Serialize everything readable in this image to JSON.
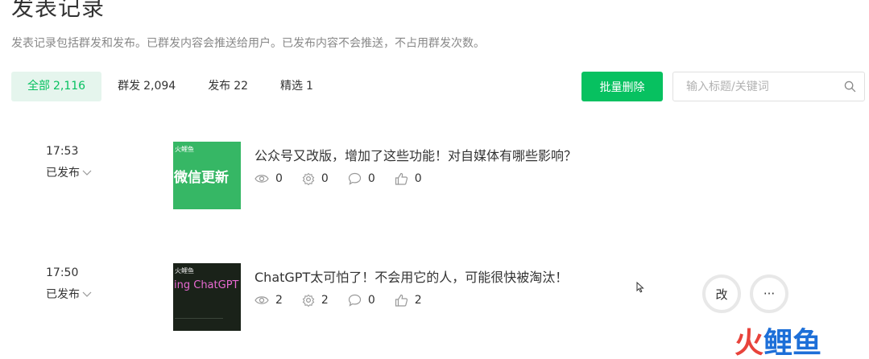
{
  "header": {
    "title": "发表记录",
    "description": "发表记录包括群发和发布。已群发内容会推送给用户。已发布内容不会推送，不占用群发次数。"
  },
  "tabs": [
    {
      "label": "全部",
      "count": "2,116",
      "active": true
    },
    {
      "label": "群发",
      "count": "2,094",
      "active": false
    },
    {
      "label": "发布",
      "count": "22",
      "active": false
    },
    {
      "label": "精选",
      "count": "1",
      "active": false
    }
  ],
  "toolbar": {
    "batch_delete_label": "批量删除",
    "search_placeholder": "输入标题/关键词"
  },
  "posts": [
    {
      "time": "17:53",
      "status": "已发布",
      "title": "公众号又改版，增加了这些功能！对自媒体有哪些影响？",
      "thumb_brand": "火鲤鱼",
      "thumb_title": "微信更新",
      "views": "0",
      "shares": "0",
      "comments": "0",
      "likes": "0"
    },
    {
      "time": "17:50",
      "status": "已发布",
      "title": "ChatGPT太可怕了！不会用它的人，可能很快被淘汰！",
      "thumb_brand": "火鲤鱼",
      "thumb_title": "ing ChatGPT",
      "views": "2",
      "shares": "2",
      "comments": "0",
      "likes": "2"
    }
  ],
  "row_actions": {
    "edit_label": "改",
    "more_label": "···"
  },
  "watermark": {
    "text": "火鲤鱼"
  },
  "colors": {
    "accent": "#07c160",
    "accent_bg": "#e5f5ed",
    "watermark_red": "#e8433b",
    "watermark_blue": "#1d6fd8"
  }
}
